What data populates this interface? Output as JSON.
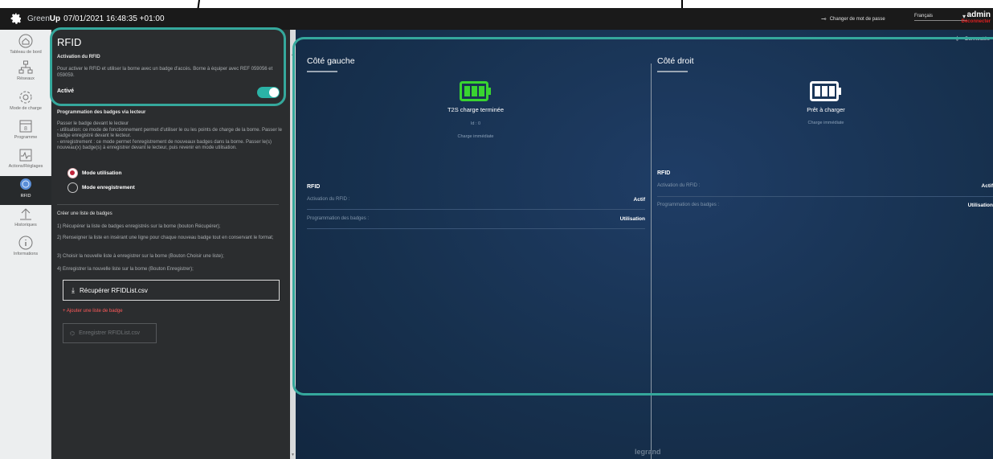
{
  "topbar": {
    "brand_green": "Green",
    "brand_up": "Up",
    "datetime": "07/01/2021 16:48:35 +01:00",
    "change_password": "Changer de mot de passe",
    "language": "Français",
    "user": "admin",
    "logout": "Déconnecter"
  },
  "sidebar": {
    "items": [
      {
        "label": "Tableau de bord",
        "icon": "home-icon"
      },
      {
        "label": "Réseaux",
        "icon": "network-icon"
      },
      {
        "label": "Mode de charge",
        "icon": "gear-icon"
      },
      {
        "label": "Programme",
        "icon": "calendar-icon"
      },
      {
        "label": "Actions/Réglages",
        "icon": "pulse-icon"
      },
      {
        "label": "RFID",
        "icon": "rfid-icon"
      },
      {
        "label": "Historiques",
        "icon": "upload-icon"
      },
      {
        "label": "Informations",
        "icon": "info-icon"
      }
    ],
    "active": "RFID"
  },
  "panel": {
    "title": "RFID",
    "activation_heading": "Activation du RFID",
    "activation_desc": "Pour activer le RFID et utiliser la borne avec un badge d'accès. Borne à équiper avec REF 059056 et 059059.",
    "activated_label": "Activé",
    "activated": true,
    "badge_prog_heading": "Programmation des badges via lecteur",
    "badge_prog_desc": "Passer le badge devant le lecteur\n- utilisation: ce mode de fonctionnement permet d'utiliser le ou les points de charge de la borne. Passer le badge enregistré devant le lecteur.\n- enregistrement : ce mode permet l'enregistrement de nouveaux badges dans la borne. Passer le(s) nouveau(x) badge(s) à enregistrer devant le lecteur, puis revenir en mode utilisation.",
    "mode_use": "Mode utilisation",
    "mode_record": "Mode enregistrement",
    "list_heading": "Créer une liste de badges",
    "steps": [
      "1) Récupérer la liste de badges enregistrés sur la borne (bouton Récupérer);",
      "2) Renseigner la liste en insérant une ligne pour chaque nouveau badge tout en conservant le format;",
      "3) Choisir la nouvelle liste à enregistrer sur la borne (Bouton Choisir une liste);",
      "4) Enregistrer la nouvelle liste sur la borne (Bouton Enregistrer);"
    ],
    "download_btn": "Récupérer RFIDList.csv",
    "add_list": "+ Ajouter une liste de badge",
    "save_btn": "Enregistrer RFIDList.csv"
  },
  "main": {
    "connected": "Connectée",
    "left": {
      "title": "Côté gauche",
      "state": "T2S charge terminée",
      "id": "Id : 0",
      "mode": "Charge immédiate",
      "rfid_title": "RFID",
      "activation_label": "Activation du RFID :",
      "activation_value": "Actif",
      "prog_label": "Programmation des badges :",
      "prog_value": "Utilisation"
    },
    "right": {
      "title": "Côté droit",
      "state": "Prêt à charger",
      "mode": "Charge immédiate",
      "rfid_title": "RFID",
      "activation_label": "Activation du RFID :",
      "activation_value": "Actif",
      "prog_label": "Programmation des badges :",
      "prog_value": "Utilisation"
    },
    "footer_logo": "legrand"
  },
  "colors": {
    "accent": "#2bb3a6",
    "highlight": "#35a89c",
    "battery_full": "#39d430",
    "danger": "#e02020"
  }
}
